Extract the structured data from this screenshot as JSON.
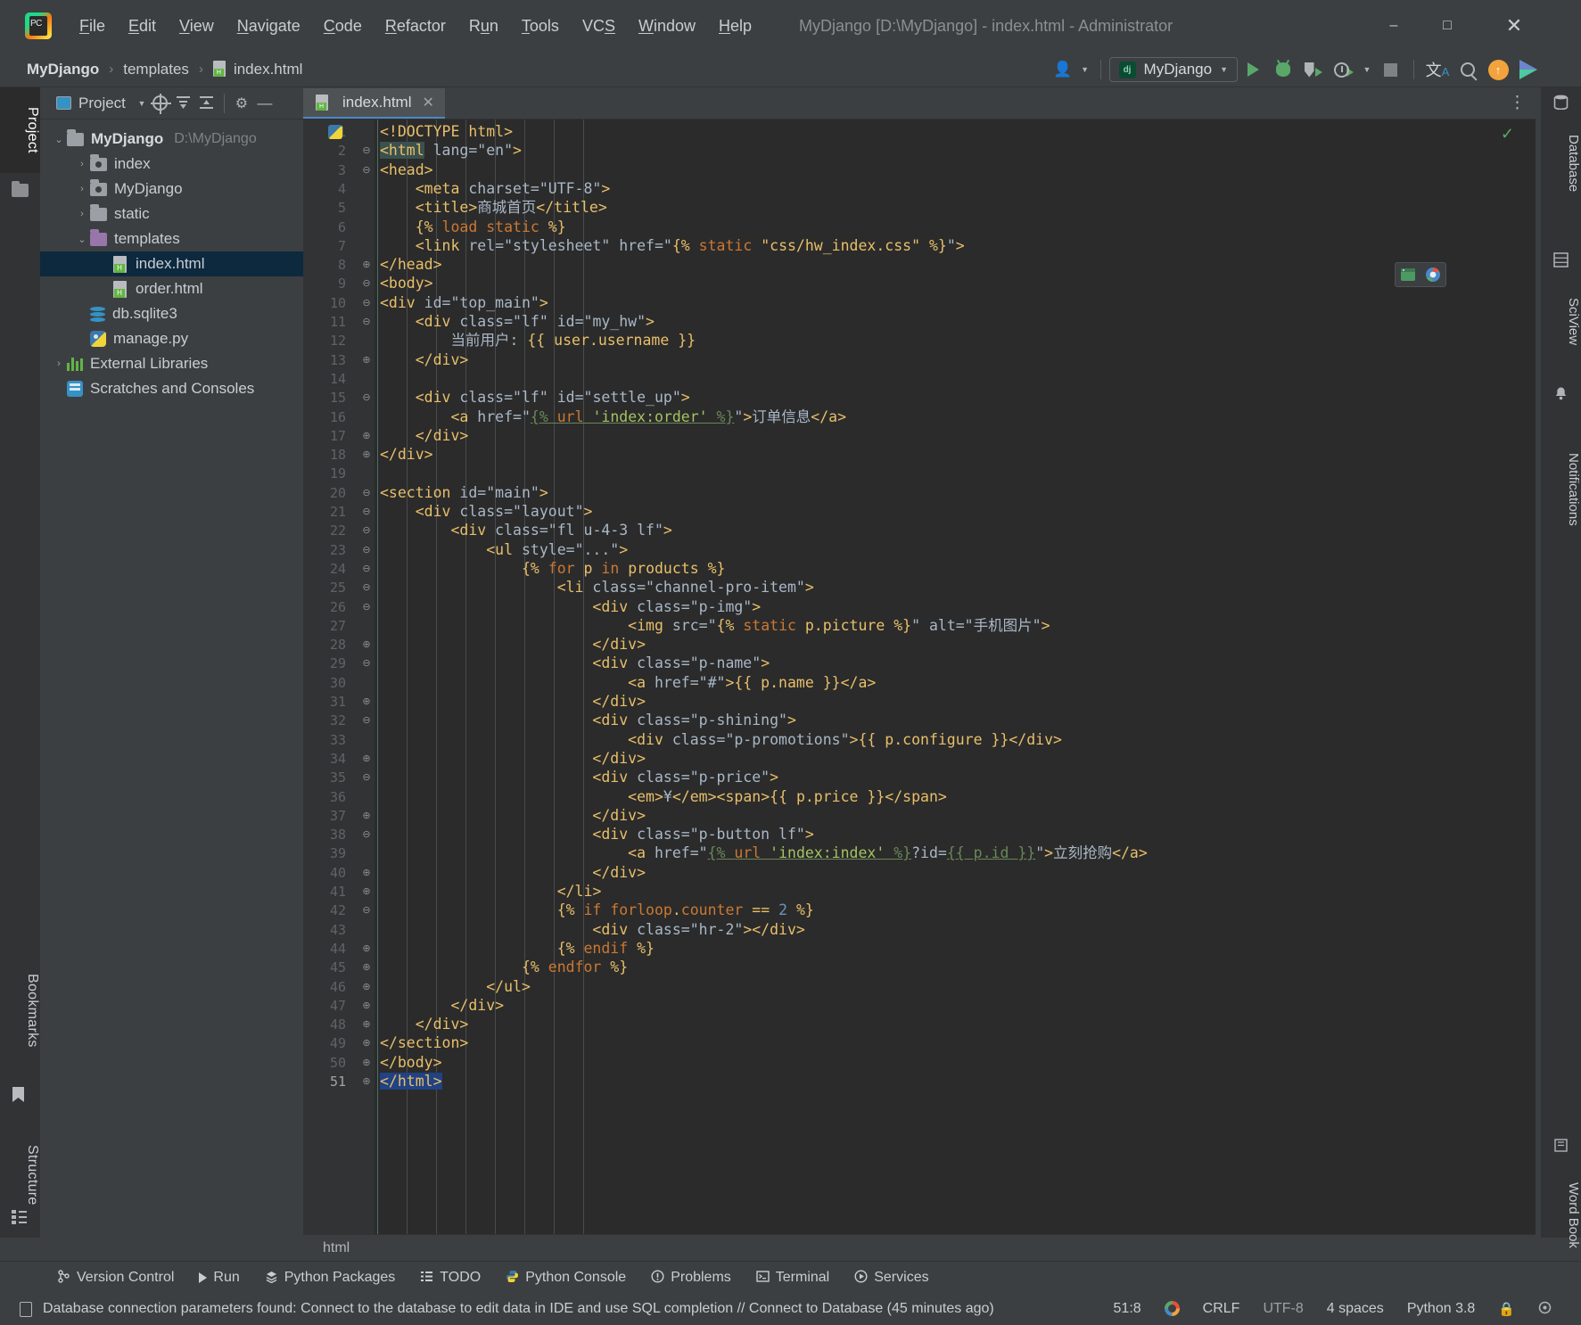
{
  "window": {
    "title": "MyDjango [D:\\MyDjango] - index.html - Administrator",
    "logo_icon": "pycharm-logo-icon",
    "minimize_icon": "minimize-icon",
    "maximize_icon": "maximize-icon",
    "close_icon": "close-icon"
  },
  "menubar": [
    {
      "label": "File",
      "mnemonic": "F"
    },
    {
      "label": "Edit",
      "mnemonic": "E"
    },
    {
      "label": "View",
      "mnemonic": "V"
    },
    {
      "label": "Navigate",
      "mnemonic": "N"
    },
    {
      "label": "Code",
      "mnemonic": "C"
    },
    {
      "label": "Refactor",
      "mnemonic": "R"
    },
    {
      "label": "Run",
      "mnemonic": "u"
    },
    {
      "label": "Tools",
      "mnemonic": "T"
    },
    {
      "label": "VCS",
      "mnemonic": "S"
    },
    {
      "label": "Window",
      "mnemonic": "W"
    },
    {
      "label": "Help",
      "mnemonic": "H"
    }
  ],
  "breadcrumbs": {
    "project": "MyDjango",
    "folder": "templates",
    "file": "index.html",
    "separator": "›",
    "file_icon": "html-file-icon"
  },
  "toolbar": {
    "account_icon": "user-account-icon",
    "run_config": {
      "label": "MyDjango",
      "icon": "django-icon",
      "caret": "▼"
    },
    "run_icon": "run-play-icon",
    "debug_icon": "debug-bug-icon",
    "coverage_icon": "run-with-coverage-icon",
    "profile_icon": "profile-clock-icon",
    "profile_caret": "▼",
    "stop_icon": "stop-square-icon",
    "translate_icon": "translate-icon",
    "search_icon": "search-everywhere-icon",
    "update_icon": "ide-update-arrow-icon",
    "play_brand_icon": "toolbox-play-icon"
  },
  "left_strips": {
    "project_tab": "Project",
    "bookmarks_tab": "Bookmarks",
    "structure_tab": "Structure",
    "folder_icon": "folder-icon",
    "bookmark_icon": "bookmark-icon",
    "structure_icon": "structure-icon"
  },
  "project_panel": {
    "title": "Project",
    "title_caret": "▾",
    "icons": {
      "panel_icon": "project-panel-icon",
      "locate_icon": "scroll-from-source-icon",
      "expand_icon": "expand-all-icon",
      "collapse_icon": "collapse-all-icon",
      "settings_icon": "gear-icon",
      "hide_icon": "hide-panel-icon"
    },
    "tree": [
      {
        "label": "MyDjango",
        "path": "D:\\MyDjango",
        "arrow": "⌄",
        "icon": "folder-icon",
        "indent": 0,
        "bold": true,
        "selected": false
      },
      {
        "label": "index",
        "path": "",
        "arrow": "›",
        "icon": "module-folder-icon",
        "indent": 1,
        "bold": false,
        "selected": false
      },
      {
        "label": "MyDjango",
        "path": "",
        "arrow": "›",
        "icon": "module-folder-icon",
        "indent": 1,
        "bold": false,
        "selected": false
      },
      {
        "label": "static",
        "path": "",
        "arrow": "›",
        "icon": "folder-icon",
        "indent": 1,
        "bold": false,
        "selected": false
      },
      {
        "label": "templates",
        "path": "",
        "arrow": "⌄",
        "icon": "templates-folder-icon",
        "indent": 1,
        "bold": false,
        "selected": false
      },
      {
        "label": "index.html",
        "path": "",
        "arrow": "",
        "icon": "html-file-icon",
        "indent": 2,
        "bold": false,
        "selected": true
      },
      {
        "label": "order.html",
        "path": "",
        "arrow": "",
        "icon": "html-file-icon",
        "indent": 2,
        "bold": false,
        "selected": false
      },
      {
        "label": "db.sqlite3",
        "path": "",
        "arrow": "",
        "icon": "database-icon",
        "indent": 1,
        "bold": false,
        "selected": false
      },
      {
        "label": "manage.py",
        "path": "",
        "arrow": "",
        "icon": "python-file-icon",
        "indent": 1,
        "bold": false,
        "selected": false
      },
      {
        "label": "External Libraries",
        "path": "",
        "arrow": "›",
        "icon": "libraries-icon",
        "indent": 0,
        "bold": false,
        "selected": false
      },
      {
        "label": "Scratches and Consoles",
        "path": "",
        "arrow": "",
        "icon": "scratches-icon",
        "indent": 0,
        "bold": false,
        "selected": false
      }
    ]
  },
  "editor": {
    "tab": {
      "label": "index.html",
      "icon": "html-file-icon",
      "close_icon": "close-icon"
    },
    "options_icon": "editor-options-icon",
    "inspection_ok_icon": "inspections-ok-check-icon",
    "float_icons": [
      "open-in-builtin-preview-icon",
      "open-in-chrome-icon"
    ],
    "breadcrumb": "html",
    "total_lines": 51,
    "lines": [
      {
        "n": 1,
        "fold": "",
        "text": "<!DOCTYPE html>"
      },
      {
        "n": 2,
        "fold": "⊖",
        "text": "<html lang=\"en\">"
      },
      {
        "n": 3,
        "fold": "⊖",
        "text": "<head>"
      },
      {
        "n": 4,
        "fold": "",
        "text": "    <meta charset=\"UTF-8\">"
      },
      {
        "n": 5,
        "fold": "",
        "text": "    <title>商城首页</title>"
      },
      {
        "n": 6,
        "fold": "",
        "text": "    {% load static %}"
      },
      {
        "n": 7,
        "fold": "",
        "text": "    <link rel=\"stylesheet\" href=\"{% static \"css/hw_index.css\" %}\">"
      },
      {
        "n": 8,
        "fold": "⊕",
        "text": "</head>"
      },
      {
        "n": 9,
        "fold": "⊖",
        "text": "<body>"
      },
      {
        "n": 10,
        "fold": "⊖",
        "text": "<div id=\"top_main\">"
      },
      {
        "n": 11,
        "fold": "⊖",
        "text": "    <div class=\"lf\" id=\"my_hw\">"
      },
      {
        "n": 12,
        "fold": "",
        "text": "        当前用户: {{ user.username }}"
      },
      {
        "n": 13,
        "fold": "⊕",
        "text": "    </div>"
      },
      {
        "n": 14,
        "fold": "",
        "text": ""
      },
      {
        "n": 15,
        "fold": "⊖",
        "text": "    <div class=\"lf\" id=\"settle_up\">"
      },
      {
        "n": 16,
        "fold": "",
        "text": "        <a href=\"{% url 'index:order' %}\">订单信息</a>"
      },
      {
        "n": 17,
        "fold": "⊕",
        "text": "    </div>"
      },
      {
        "n": 18,
        "fold": "⊕",
        "text": "</div>"
      },
      {
        "n": 19,
        "fold": "",
        "text": ""
      },
      {
        "n": 20,
        "fold": "⊖",
        "text": "<section id=\"main\">"
      },
      {
        "n": 21,
        "fold": "⊖",
        "text": "    <div class=\"layout\">"
      },
      {
        "n": 22,
        "fold": "⊖",
        "text": "        <div class=\"fl u-4-3 lf\">"
      },
      {
        "n": 23,
        "fold": "⊖",
        "text": "            <ul style=\"...\">"
      },
      {
        "n": 24,
        "fold": "⊖",
        "text": "                {% for p in products %}"
      },
      {
        "n": 25,
        "fold": "⊖",
        "text": "                    <li class=\"channel-pro-item\">"
      },
      {
        "n": 26,
        "fold": "⊖",
        "text": "                        <div class=\"p-img\">"
      },
      {
        "n": 27,
        "fold": "",
        "text": "                            <img src=\"{% static p.picture %}\" alt=\"手机图片\">"
      },
      {
        "n": 28,
        "fold": "⊕",
        "text": "                        </div>"
      },
      {
        "n": 29,
        "fold": "⊖",
        "text": "                        <div class=\"p-name\">"
      },
      {
        "n": 30,
        "fold": "",
        "text": "                            <a href=\"#\">{{ p.name }}</a>"
      },
      {
        "n": 31,
        "fold": "⊕",
        "text": "                        </div>"
      },
      {
        "n": 32,
        "fold": "⊖",
        "text": "                        <div class=\"p-shining\">"
      },
      {
        "n": 33,
        "fold": "",
        "text": "                            <div class=\"p-promotions\">{{ p.configure }}</div>"
      },
      {
        "n": 34,
        "fold": "⊕",
        "text": "                        </div>"
      },
      {
        "n": 35,
        "fold": "⊖",
        "text": "                        <div class=\"p-price\">"
      },
      {
        "n": 36,
        "fold": "",
        "text": "                            <em>¥</em><span>{{ p.price }}</span>"
      },
      {
        "n": 37,
        "fold": "⊕",
        "text": "                        </div>"
      },
      {
        "n": 38,
        "fold": "⊖",
        "text": "                        <div class=\"p-button lf\">"
      },
      {
        "n": 39,
        "fold": "",
        "text": "                            <a href=\"{% url 'index:index' %}?id={{ p.id }}\">立刻抢购</a>"
      },
      {
        "n": 40,
        "fold": "⊕",
        "text": "                        </div>"
      },
      {
        "n": 41,
        "fold": "⊕",
        "text": "                    </li>"
      },
      {
        "n": 42,
        "fold": "⊖",
        "text": "                    {% if forloop.counter == 2 %}"
      },
      {
        "n": 43,
        "fold": "",
        "text": "                        <div class=\"hr-2\"></div>"
      },
      {
        "n": 44,
        "fold": "⊕",
        "text": "                    {% endif %}"
      },
      {
        "n": 45,
        "fold": "⊕",
        "text": "                {% endfor %}"
      },
      {
        "n": 46,
        "fold": "⊕",
        "text": "            </ul>"
      },
      {
        "n": 47,
        "fold": "⊕",
        "text": "        </div>"
      },
      {
        "n": 48,
        "fold": "⊕",
        "text": "    </div>"
      },
      {
        "n": 49,
        "fold": "⊕",
        "text": "</section>"
      },
      {
        "n": 50,
        "fold": "⊕",
        "text": "</body>"
      },
      {
        "n": 51,
        "fold": "⊕",
        "text": "</html>"
      }
    ]
  },
  "right_strips": {
    "database_tab": "Database",
    "sciview_tab": "SciView",
    "notifications_tab": "Notifications",
    "word_book_tab": "Word Book",
    "database_icon": "database-icon",
    "sciview_icon": "sciview-grid-icon",
    "notifications_icon": "notifications-bell-icon",
    "word_book_icon": "word-book-icon"
  },
  "bottom_toolwindows": [
    {
      "label": "Version Control",
      "icon": "version-control-branch-icon"
    },
    {
      "label": "Run",
      "icon": "run-play-icon"
    },
    {
      "label": "Python Packages",
      "icon": "python-packages-icon"
    },
    {
      "label": "TODO",
      "icon": "todo-list-icon"
    },
    {
      "label": "Python Console",
      "icon": "python-console-icon"
    },
    {
      "label": "Problems",
      "icon": "problems-warning-icon"
    },
    {
      "label": "Terminal",
      "icon": "terminal-icon"
    },
    {
      "label": "Services",
      "icon": "services-play-icon"
    }
  ],
  "statusbar": {
    "message": "Database connection parameters found: Connect to the database to edit data in IDE and use SQL completion // Connect to Database (45 minutes ago)",
    "message_icon": "notification-doc-icon",
    "caret_position": "51:8",
    "google_icon": "google-translate-icon",
    "line_separator": "CRLF",
    "encoding": "UTF-8",
    "indent": "4 spaces",
    "interpreter": "Python 3.8",
    "lock_icon": "read-only-lock-icon",
    "inspection_icon": "inspection-widget-icon"
  },
  "colors": {
    "accent": "#4a88c7",
    "editor_bg": "#2b2b2b",
    "panel_bg": "#3c3f41",
    "selection": "#0d293e",
    "green": "#59a869",
    "tag": "#e8bf6a",
    "attr_value": "#a5c261",
    "orange": "#cc7832"
  }
}
